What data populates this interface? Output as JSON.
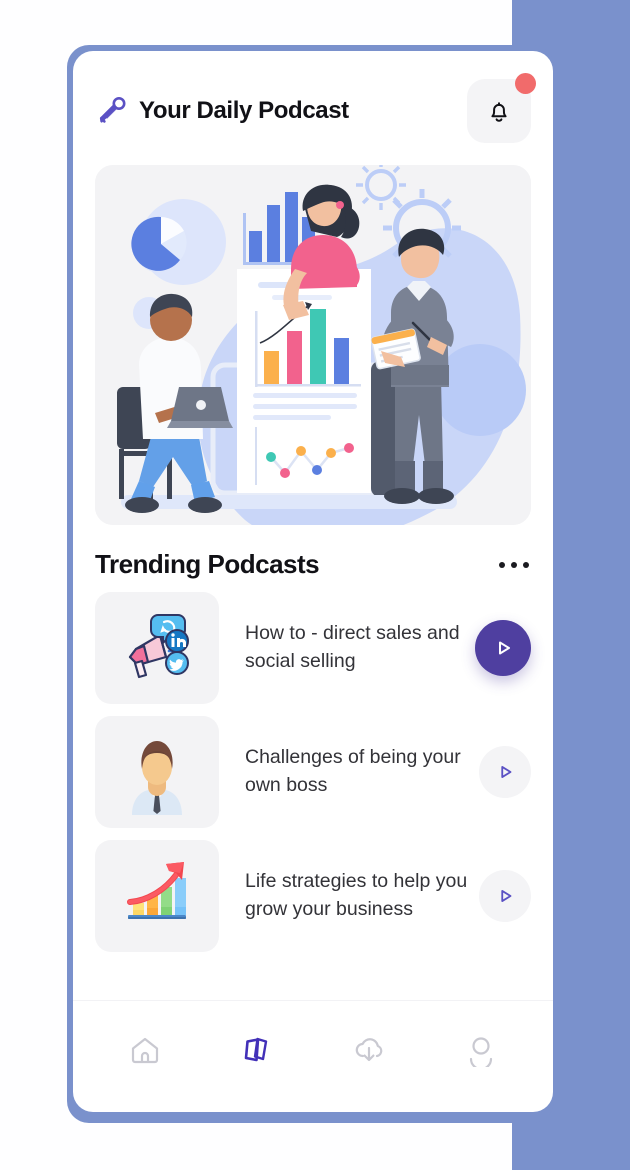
{
  "theme": {
    "backdrop_blue": "#7A91CC",
    "accent_purple": "#4F3FA0",
    "card_white": "#FFFFFF",
    "tile_grey": "#F3F3F5",
    "badge_red": "#F16B6B",
    "text_dark": "#111116",
    "text_body": "#333338",
    "nav_inactive": "#C9C9D1"
  },
  "header": {
    "mic_icon": "microphone-icon",
    "title": "Your Daily Podcast",
    "notification_icon": "bell-icon",
    "notification_badge": true
  },
  "hero": {
    "name": "business-analytics-illustration",
    "alt": "Team analyzing charts and reports",
    "elements": [
      "pie-chart",
      "bar-chart",
      "gears",
      "document-report",
      "seated-man-with-laptop",
      "woman-on-document",
      "standing-man-with-clipboard"
    ],
    "palette": {
      "blob": "#C5D3F7",
      "blue": "#5B7FE0",
      "orange": "#FBB04C",
      "pink": "#F2628D",
      "teal": "#3FC8B4",
      "grey_suit": "#6E7687",
      "skin_light": "#F2C0A0",
      "skin_dark": "#B5724C"
    }
  },
  "section": {
    "title": "Trending Podcasts",
    "more_icon": "more-options-icon"
  },
  "podcasts": [
    {
      "title": "How to - direct sales and social selling",
      "thumb_icon": "megaphone-social-icon",
      "play_state": "active",
      "play_icon": "play-icon"
    },
    {
      "title": "Challenges of being your own boss",
      "thumb_icon": "businessman-avatar-icon",
      "play_state": "inactive",
      "play_icon": "play-icon"
    },
    {
      "title": "Life strategies to help you grow your business",
      "thumb_icon": "growth-chart-icon",
      "play_state": "inactive",
      "play_icon": "play-icon"
    }
  ],
  "bottom_nav": {
    "items": [
      {
        "icon": "home-icon",
        "label": "Home",
        "active": false
      },
      {
        "icon": "cards-library-icon",
        "label": "Library",
        "active": true
      },
      {
        "icon": "download-cloud-icon",
        "label": "Downloads",
        "active": false
      },
      {
        "icon": "profile-icon",
        "label": "Profile",
        "active": false
      }
    ]
  }
}
